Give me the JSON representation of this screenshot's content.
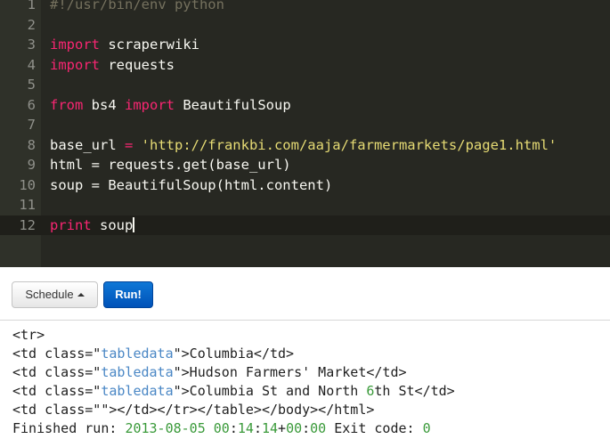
{
  "editor": {
    "lines": [
      {
        "n": "1",
        "kind": "comment",
        "text": "#!/usr/bin/env python"
      },
      {
        "n": "2",
        "kind": "empty"
      },
      {
        "n": "3",
        "kind": "import",
        "kw": "import",
        "rest": " scraperwiki"
      },
      {
        "n": "4",
        "kind": "import",
        "kw": "import",
        "rest": " requests"
      },
      {
        "n": "5",
        "kind": "empty"
      },
      {
        "n": "6",
        "kind": "from",
        "kw1": "from",
        "mid": " bs4 ",
        "kw2": "import",
        "rest": " BeautifulSoup"
      },
      {
        "n": "7",
        "kind": "empty"
      },
      {
        "n": "8",
        "kind": "assign_str",
        "name": "base_url",
        "op": " = ",
        "str": "'http://frankbi.com/aaja/farmermarkets/page1.html'"
      },
      {
        "n": "9",
        "kind": "plain",
        "text": "html = requests.get(base_url)"
      },
      {
        "n": "10",
        "kind": "plain",
        "text": "soup = BeautifulSoup(html.content)"
      },
      {
        "n": "11",
        "kind": "empty"
      },
      {
        "n": "12",
        "kind": "print",
        "kw": "print",
        "rest": " soup",
        "active": true
      }
    ],
    "colors": {
      "background": "#272822",
      "keyword": "#f92672",
      "string": "#e6db74",
      "comment": "#75715e",
      "text": "#f8f8f2"
    }
  },
  "toolbar": {
    "schedule_label": "Schedule",
    "run_label": "Run!"
  },
  "console": {
    "line1": "<tr>",
    "line2": {
      "pre": "<td class=\"",
      "attr": "tabledata",
      "post": "\">Columbia</td>"
    },
    "line3": {
      "pre": "<td class=\"",
      "attr": "tabledata",
      "post": "\">Hudson Farmers' Market</td>"
    },
    "line4": {
      "pre": "<td class=\"",
      "attr": "tabledata",
      "post_a": "\">Columbia St and North ",
      "num": "6",
      "post_b": "th St</td>"
    },
    "line5": "<td class=\"\"></td></tr></table></body></html>",
    "finished": {
      "label": "Finished run: ",
      "date": "2013-08-05",
      "space": " ",
      "time_h": "00",
      "c1": ":",
      "time_m": "14",
      "c2": ":",
      "time_s": "14",
      "tz_sign": "+",
      "tz_h": "00",
      "c3": ":",
      "tz_m": "00",
      "exit_label": " Exit code: ",
      "exit_code": "0"
    }
  }
}
